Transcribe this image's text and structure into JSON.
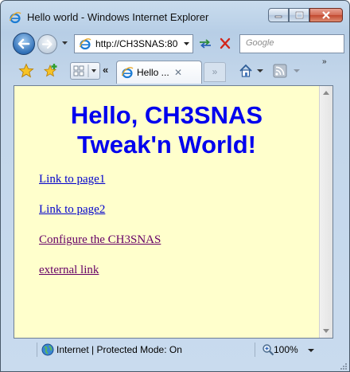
{
  "window": {
    "title": "Hello world - Windows Internet Explorer"
  },
  "navigation": {
    "address_value": "http://CH3SNAS:80",
    "search_placeholder": "Google"
  },
  "tabs": [
    {
      "label": "Hello ...",
      "close": "✕"
    }
  ],
  "toolbar": {
    "chevron_label": "«",
    "new_tab_label": "»",
    "more_label": "»"
  },
  "page": {
    "heading_line1": "Hello, CH3SNAS",
    "heading_line2": "Tweak'n World!",
    "links": [
      {
        "text": "Link to page1",
        "state": "unvisited"
      },
      {
        "text": "Link to page2",
        "state": "unvisited"
      },
      {
        "text": "Configure the CH3SNAS",
        "state": "visited"
      },
      {
        "text": "external link",
        "state": "visited"
      }
    ]
  },
  "status": {
    "zone_text": "Internet | Protected Mode: On",
    "zoom": "100%"
  },
  "colors": {
    "page_background": "#ffffcc",
    "heading": "#0000ee",
    "link": "#0000cc",
    "visited_link": "#660066"
  }
}
